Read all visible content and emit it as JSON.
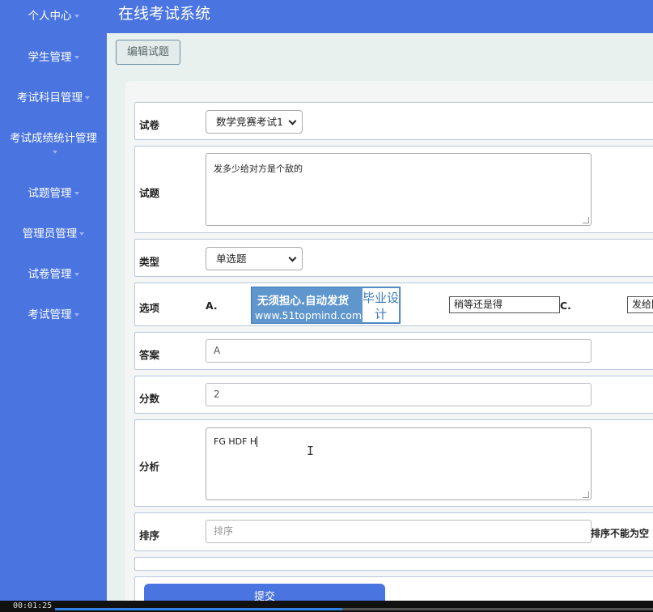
{
  "header": {
    "title": "在线考试系统"
  },
  "sidebar": {
    "items": [
      {
        "label": "个人中心"
      },
      {
        "label": "学生管理"
      },
      {
        "label": "考试科目管理"
      },
      {
        "label": "考试成绩统计管理"
      },
      {
        "label": "试题管理"
      },
      {
        "label": "管理员管理"
      },
      {
        "label": "试卷管理"
      },
      {
        "label": "考试管理"
      }
    ]
  },
  "toolbar": {
    "edit_label": "编辑试题"
  },
  "form": {
    "paper": {
      "label": "试卷",
      "value": "数学竞赛考试1"
    },
    "question": {
      "label": "试题",
      "value": "发多少给对方是个敌的"
    },
    "type": {
      "label": "类型",
      "value": "单选题"
    },
    "options": {
      "label": "选项",
      "a_letter": "A.",
      "b_value": "稍等还是得",
      "c_letter": "C.",
      "c_value": "发给回"
    },
    "answer": {
      "label": "答案",
      "value": "A"
    },
    "score": {
      "label": "分数",
      "value": "2"
    },
    "analysis": {
      "label": "分析",
      "value": "FG HDF H"
    },
    "order": {
      "label": "排序",
      "placeholder": "排序",
      "error": "排序不能为空"
    },
    "submit_label": "提交"
  },
  "watermark": {
    "line1": "无须担心.自动发货",
    "line2": "www.51topmind.com",
    "badge": "毕业设计"
  },
  "video": {
    "time": "00:01:25",
    "progress": 0.48
  }
}
